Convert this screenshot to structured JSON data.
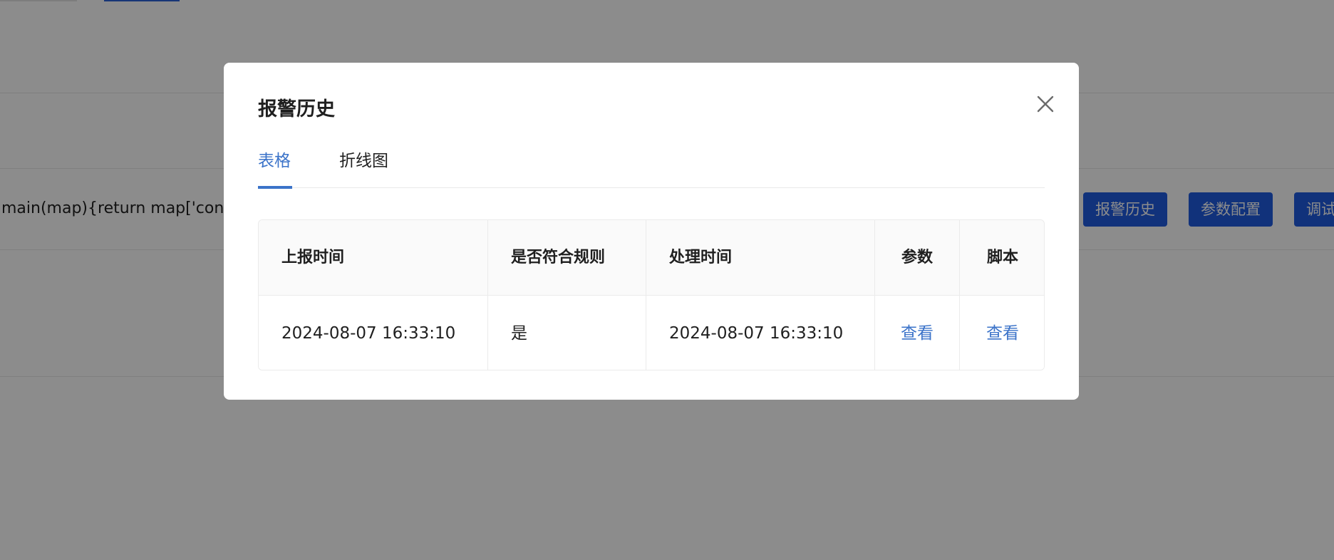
{
  "background": {
    "code_snippet": "main(map){return map['cond",
    "action_buttons": [
      "报警历史",
      "参数配置",
      "调试"
    ]
  },
  "modal": {
    "title": "报警历史",
    "close_icon": "close-icon",
    "tabs": [
      {
        "label": "表格",
        "active": true
      },
      {
        "label": "折线图",
        "active": false
      }
    ],
    "table": {
      "columns": [
        "上报时间",
        "是否符合规则",
        "处理时间",
        "参数",
        "脚本"
      ],
      "rows": [
        {
          "report_time": "2024-08-07 16:33:10",
          "matches_rule": "是",
          "process_time": "2024-08-07 16:33:10",
          "params_action": "查看",
          "script_action": "查看"
        }
      ]
    }
  },
  "colors": {
    "accent": "#3b73c9",
    "button_bg": "#1f5be0",
    "mask": "rgba(0,0,0,0.45)"
  }
}
